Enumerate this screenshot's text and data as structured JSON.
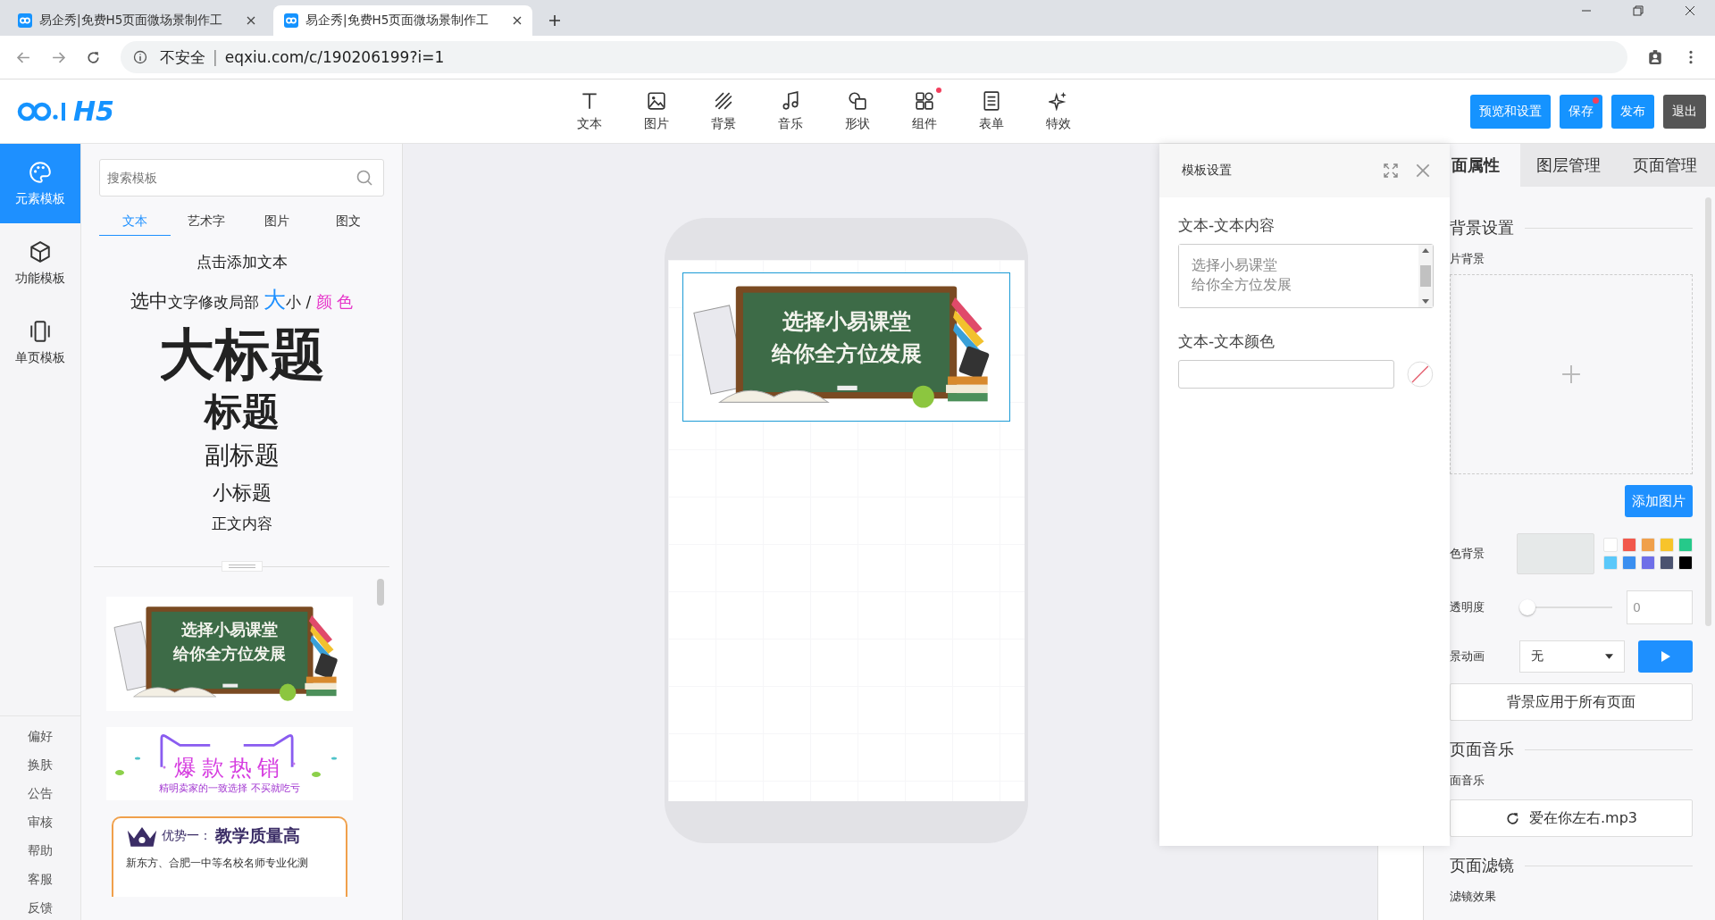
{
  "browser": {
    "tabs": [
      {
        "title": "易企秀|免费H5页面微场景制作工",
        "selected": false
      },
      {
        "title": "易企秀|免费H5页面微场景制作工",
        "selected": true
      }
    ],
    "security": "不安全",
    "separator": "|",
    "url": "eqxiu.com/c/190206199?i=1"
  },
  "header": {
    "logo": "H5",
    "tools": [
      {
        "label": "文本",
        "kind": "text",
        "dot": false
      },
      {
        "label": "图片",
        "kind": "image",
        "dot": false
      },
      {
        "label": "背景",
        "kind": "background",
        "dot": false
      },
      {
        "label": "音乐",
        "kind": "music",
        "dot": false
      },
      {
        "label": "形状",
        "kind": "shape",
        "dot": false
      },
      {
        "label": "组件",
        "kind": "component",
        "dot": true
      },
      {
        "label": "表单",
        "kind": "form",
        "dot": false
      },
      {
        "label": "特效",
        "kind": "effect",
        "dot": false
      }
    ],
    "buttons": [
      {
        "label": "预览和设置",
        "kind": "primary",
        "dot": false
      },
      {
        "label": "保存",
        "kind": "primary",
        "dot": true
      },
      {
        "label": "发布",
        "kind": "primary",
        "dot": false
      },
      {
        "label": "退出",
        "kind": "dark",
        "dot": false
      }
    ]
  },
  "nav": {
    "items": [
      {
        "label": "元素模板",
        "kind": "palette",
        "selected": true
      },
      {
        "label": "功能模板",
        "kind": "cube",
        "selected": false
      },
      {
        "label": "单页模板",
        "kind": "page",
        "selected": false
      }
    ],
    "links": [
      "偏好",
      "换肤",
      "公告",
      "审核",
      "帮助",
      "客服",
      "反馈"
    ]
  },
  "library": {
    "search": {
      "placeholder": "搜索模板"
    },
    "tabs": [
      {
        "label": "文本",
        "selected": true
      },
      {
        "label": "艺术字",
        "selected": false
      },
      {
        "label": "图片",
        "selected": false
      },
      {
        "label": "图文",
        "selected": false
      }
    ],
    "samples": [
      {
        "kind": "plain",
        "text": "点击添加文本"
      },
      {
        "kind": "mixed",
        "parts": [
          {
            "kind": "large",
            "text": "选中"
          },
          {
            "kind": "normal",
            "text": "文字修改局部 "
          },
          {
            "kind": "blue",
            "text": "大"
          },
          {
            "kind": "normal",
            "text": "小 / "
          },
          {
            "kind": "pink",
            "text": "颜 色"
          }
        ]
      },
      {
        "kind": "h1",
        "text": "大标题"
      },
      {
        "kind": "h2",
        "text": "标题"
      },
      {
        "kind": "h3",
        "text": "副标题"
      },
      {
        "kind": "h4",
        "text": "小标题"
      },
      {
        "kind": "body",
        "text": "正文内容"
      }
    ],
    "templates": [
      {
        "kind": "chalkboard",
        "lines": [
          "选择小易课堂",
          "给你全方位发展"
        ]
      },
      {
        "kind": "sale",
        "title": "爆款热销",
        "subtitle": "精明卖家的一致选择 不买就吃亏"
      },
      {
        "kind": "advantage",
        "prefix": "优势一：",
        "title": "教学质量高",
        "body": "新东方、合肥一中等名校名师专业化测"
      }
    ]
  },
  "canvas": {
    "element": {
      "lines": [
        "选择小易课堂",
        "给你全方位发展"
      ],
      "selected": true
    }
  },
  "template_settings": {
    "title": "模板设置",
    "fields": [
      {
        "label": "文本-文本内容",
        "kind": "textarea",
        "lines": [
          "选择小易课堂",
          "给你全方位发展"
        ]
      },
      {
        "label": "文本-文本颜色",
        "kind": "color"
      }
    ]
  },
  "properties": {
    "tabs": [
      {
        "label": "面属性",
        "selected": true
      },
      {
        "label": "图层管理",
        "selected": false
      },
      {
        "label": "页面管理",
        "selected": false
      }
    ],
    "background": {
      "heading": "背景设置",
      "image_label": "片背景",
      "add_button": "添加图片",
      "color_label": "色背景",
      "swatches": [
        {
          "color": "#ffffff"
        },
        {
          "color": "#f2584c"
        },
        {
          "color": "#f0a04b"
        },
        {
          "color": "#f7c42b"
        },
        {
          "color": "#26c98a"
        },
        {
          "color": "#5ac8fa"
        },
        {
          "color": "#3b8ff0"
        },
        {
          "color": "#6f6fe8"
        },
        {
          "color": "#4a5270"
        },
        {
          "color": "#000000"
        }
      ],
      "opacity_label": "透明度",
      "opacity": {
        "level": 0
      },
      "opacity_value": "0",
      "animation_label": "景动画",
      "animation_value": "无",
      "apply_button": "背景应用于所有页面"
    },
    "music": {
      "heading": "页面音乐",
      "label": "面音乐",
      "file": "爱在你左右.mp3"
    },
    "filter": {
      "heading": "页面滤镜",
      "label": "滤镜效果"
    }
  }
}
